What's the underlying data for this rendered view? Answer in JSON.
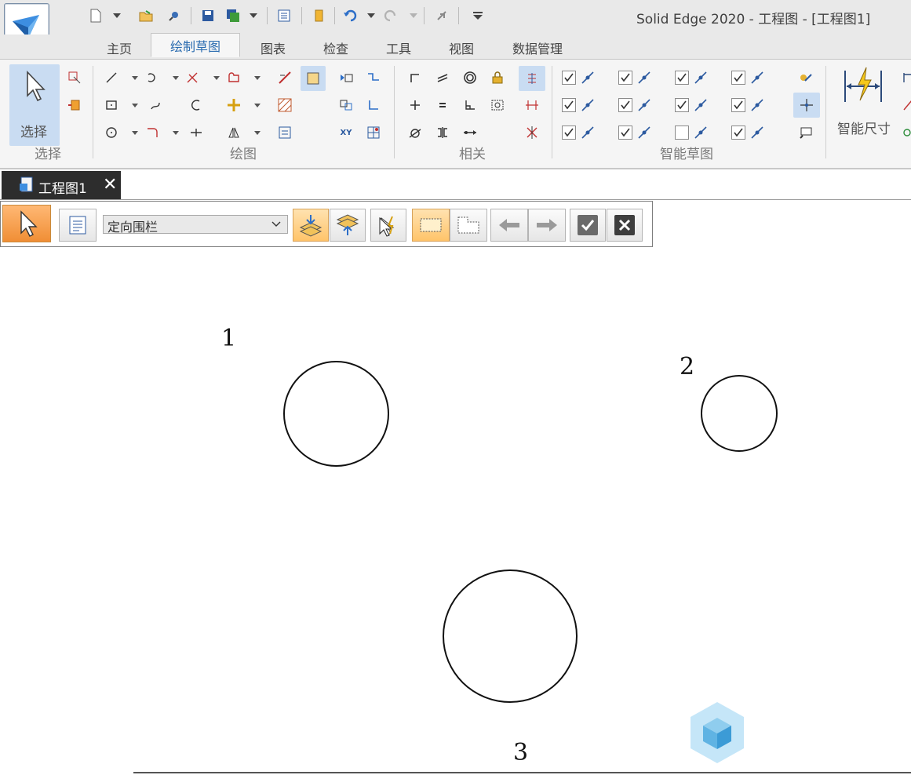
{
  "window": {
    "title": "Solid Edge 2020 - 工程图 - [工程图1]"
  },
  "quick_access": {
    "icons": [
      "new-document-icon",
      "open-icon",
      "search-icon",
      "save-icon",
      "save-all-icon",
      "properties-icon",
      "bookmark-icon",
      "undo-icon",
      "redo-icon",
      "measure-icon",
      "customize-icon"
    ]
  },
  "ribbon": {
    "tabs": [
      {
        "label": "主页",
        "active": false
      },
      {
        "label": "绘制草图",
        "active": true
      },
      {
        "label": "图表",
        "active": false
      },
      {
        "label": "检查",
        "active": false
      },
      {
        "label": "工具",
        "active": false
      },
      {
        "label": "视图",
        "active": false
      },
      {
        "label": "数据管理",
        "active": false
      }
    ],
    "groups": {
      "select": {
        "label": "选择",
        "button_label": "选择"
      },
      "draw": {
        "label": "绘图"
      },
      "relate": {
        "label": "相关"
      },
      "intellisketch": {
        "label": "智能草图"
      },
      "smart_dimension": {
        "label": "智能尺寸"
      }
    }
  },
  "document_tab": {
    "label": "工程图1",
    "close": "✕"
  },
  "command_bar": {
    "select_mode": "定向围栏",
    "buttons": [
      "select-arrow",
      "options",
      "add-to-selection",
      "remove-from-selection",
      "select-filter",
      "inside-fence",
      "overlap-fence",
      "previous",
      "next",
      "accept",
      "cancel"
    ]
  },
  "canvas": {
    "circles": [
      {
        "label": "1"
      },
      {
        "label": "2"
      },
      {
        "label": "3"
      }
    ]
  },
  "colors": {
    "accent": "#2b6cb0",
    "selected_orange": "#f08e35",
    "ribbon_bg": "#f5f5f5",
    "titlebar_bg": "#e9e9e9"
  }
}
